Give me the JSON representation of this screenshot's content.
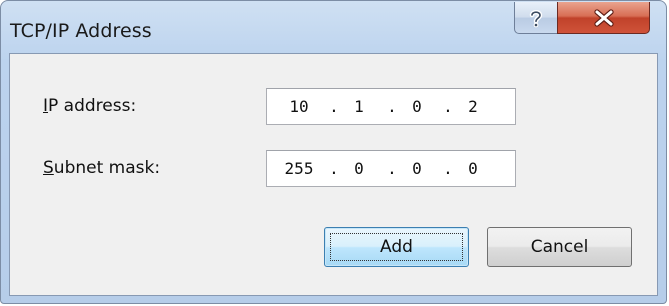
{
  "window": {
    "title": "TCP/IP Address",
    "help_icon": "question-mark-icon",
    "close_icon": "close-x-icon"
  },
  "form": {
    "ip_address": {
      "label_mnemonic": "I",
      "label_rest": "P address:",
      "octets": [
        "10",
        "1",
        "0",
        "2"
      ]
    },
    "subnet_mask": {
      "label_mnemonic": "S",
      "label_rest": "ubnet mask:",
      "octets": [
        "255",
        "0",
        "0",
        "0"
      ]
    },
    "separator": "."
  },
  "buttons": {
    "add_label": "Add",
    "cancel_label": "Cancel"
  },
  "colors": {
    "title_bar": "#bcd3ee",
    "close_button": "#c7442c",
    "default_button": "#3c7fb1"
  }
}
